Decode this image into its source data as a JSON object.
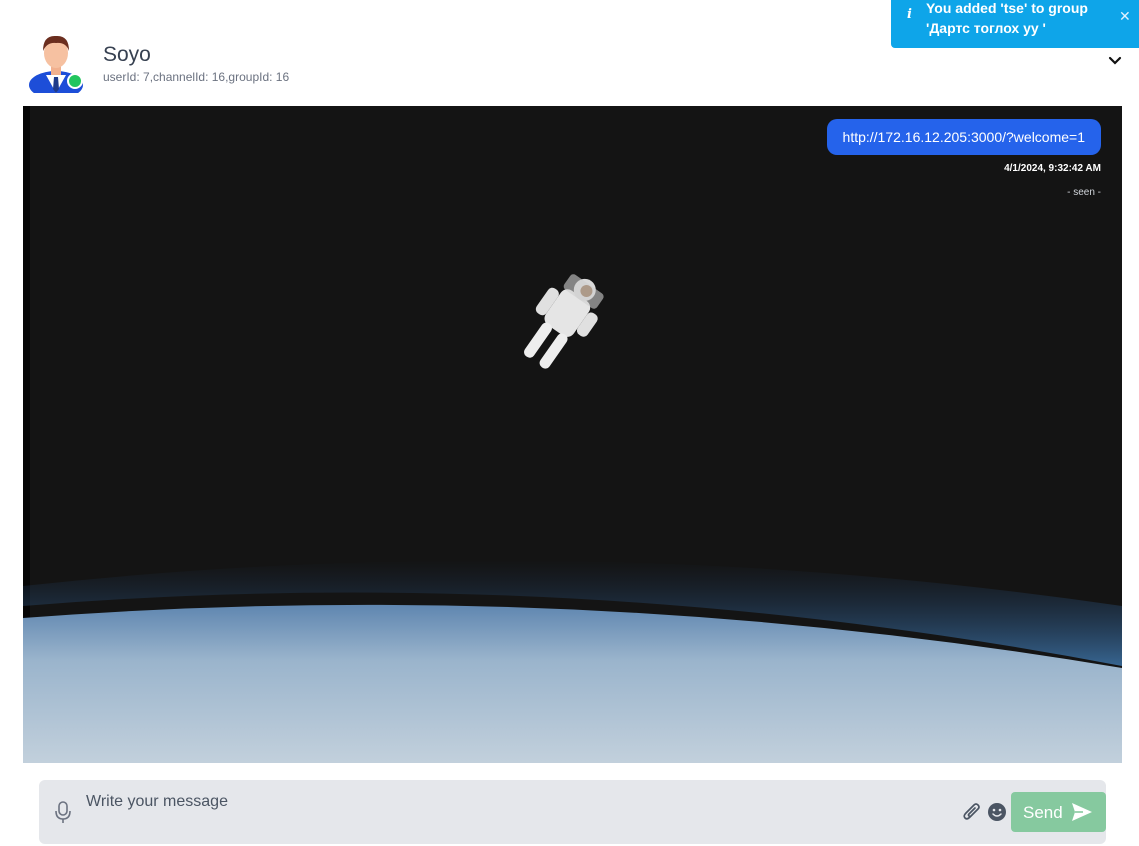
{
  "toast": {
    "info_icon": "i",
    "message": "You added 'tse' to group 'Дартс тоглох уу '",
    "close_icon": "✕"
  },
  "header": {
    "name": "Soyo",
    "meta": "userId: 7,channelId: 16,groupId: 16",
    "status_color": "#22c55e"
  },
  "messages": [
    {
      "text": "http://172.16.12.205:3000/?welcome=1",
      "timestamp": "4/1/2024, 9:32:42 AM",
      "status": "- seen -"
    }
  ],
  "composer": {
    "placeholder": "Write your message",
    "send_label": "Send"
  },
  "colors": {
    "accent": "#2563eb",
    "toast": "#0ea5e9",
    "send": "#86c99f"
  }
}
